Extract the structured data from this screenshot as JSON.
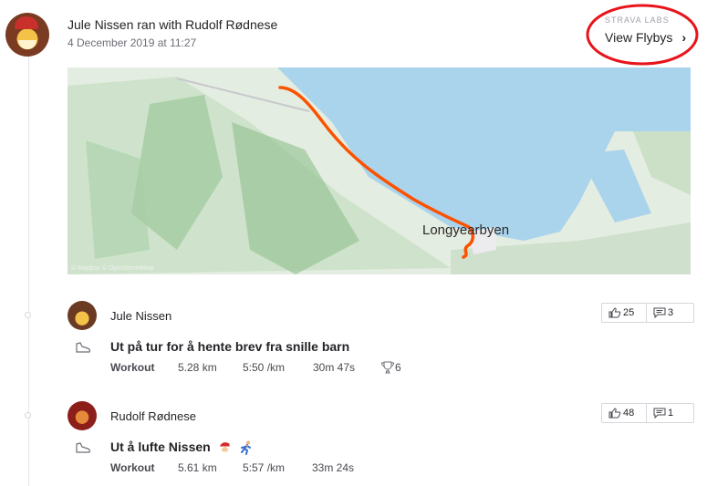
{
  "header": {
    "title": "Jule Nissen ran with Rudolf Rødnese",
    "date": "4 December 2019 at 11:27",
    "flyby_lab": "STRAVA LABS",
    "flyby_link": "View Flybys",
    "flyby_chevron": "›"
  },
  "map": {
    "label": "Longyearbyen",
    "credit": "© Mapbox © OpenStreetMap",
    "route_color": "#fc5200",
    "water_color": "#aad3ec"
  },
  "activities": [
    {
      "athlete": "Jule Nissen",
      "title": "Ut på tur for å hente brev fra snille barn",
      "type": "Workout",
      "distance": "5.28 km",
      "pace": "5:50 /km",
      "time": "30m 47s",
      "achievements": "6",
      "kudos": "25",
      "comments": "3"
    },
    {
      "athlete": "Rudolf Rødnese",
      "title": "Ut å lufte Nissen",
      "type": "Workout",
      "distance": "5.61 km",
      "pace": "5:57 /km",
      "time": "33m 24s",
      "kudos": "48",
      "comments": "1"
    }
  ],
  "icons": {
    "kudos": "thumbs-up-icon",
    "comment": "comment-icon",
    "shoe": "run-shoe-icon",
    "trophy": "trophy-icon",
    "santa": "santa-emoji",
    "runner": "runner-emoji"
  },
  "colors": {
    "highlight_ring": "#e8141b",
    "text": "#242428"
  }
}
